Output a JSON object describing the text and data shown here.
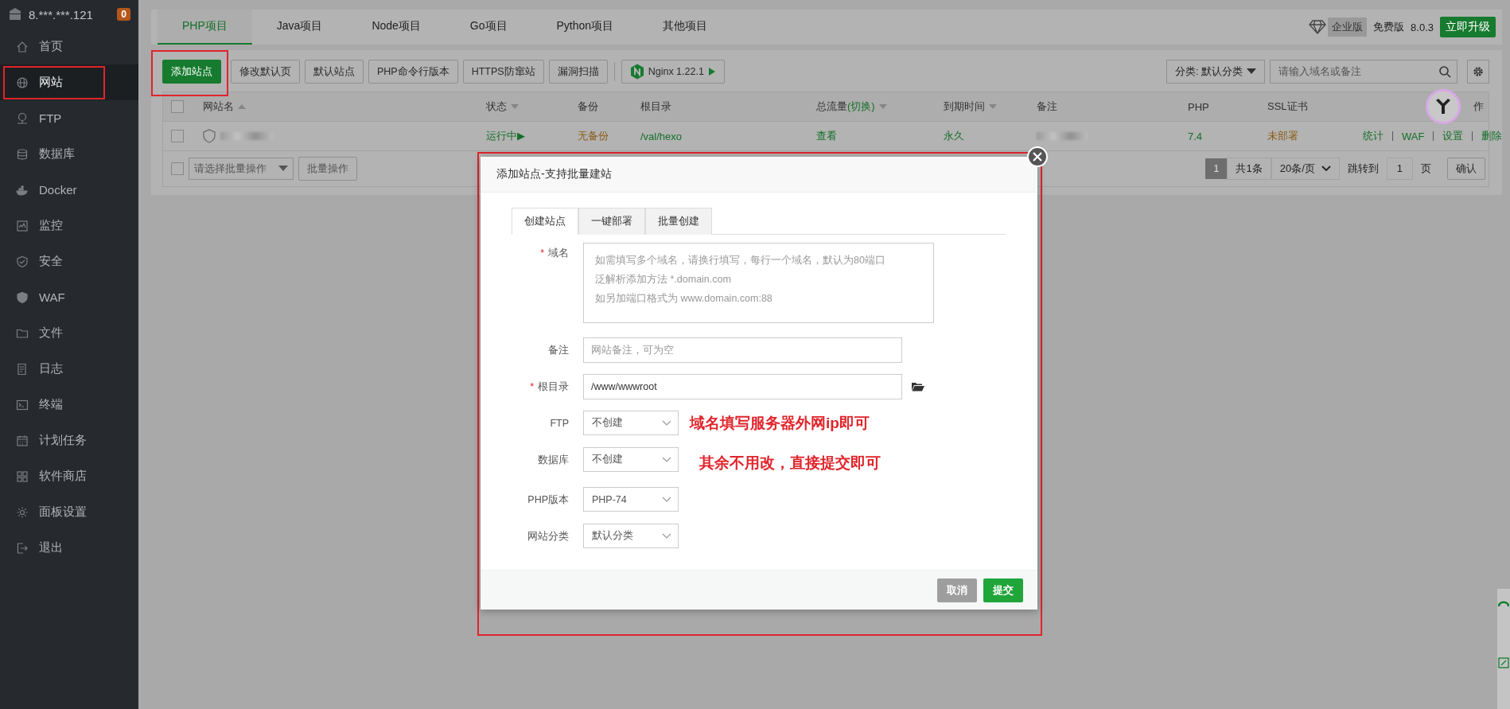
{
  "sidebar": {
    "server": "8.***.***.121",
    "badge": "0",
    "items": [
      {
        "label": "首页",
        "selected": false,
        "annotated": false
      },
      {
        "label": "网站",
        "selected": true,
        "annotated": true
      },
      {
        "label": "FTP",
        "selected": false,
        "annotated": false
      },
      {
        "label": "数据库",
        "selected": false,
        "annotated": false
      },
      {
        "label": "Docker",
        "selected": false,
        "annotated": false
      },
      {
        "label": "监控",
        "selected": false,
        "annotated": false
      },
      {
        "label": "安全",
        "selected": false,
        "annotated": false
      },
      {
        "label": "WAF",
        "selected": false,
        "annotated": false
      },
      {
        "label": "文件",
        "selected": false,
        "annotated": false
      },
      {
        "label": "日志",
        "selected": false,
        "annotated": false
      },
      {
        "label": "终端",
        "selected": false,
        "annotated": false
      },
      {
        "label": "计划任务",
        "selected": false,
        "annotated": false
      },
      {
        "label": "软件商店",
        "selected": false,
        "annotated": false
      },
      {
        "label": "面板设置",
        "selected": false,
        "annotated": false
      },
      {
        "label": "退出",
        "selected": false,
        "annotated": false
      }
    ]
  },
  "project_tabs": [
    {
      "label": "PHP项目",
      "selected": true
    },
    {
      "label": "Java项目",
      "selected": false
    },
    {
      "label": "Node项目",
      "selected": false
    },
    {
      "label": "Go项目",
      "selected": false
    },
    {
      "label": "Python项目",
      "selected": false
    },
    {
      "label": "其他项目",
      "selected": false
    }
  ],
  "edition": {
    "enterprise": "企业版",
    "free": "免费版",
    "version": "8.0.3",
    "upgrade": "立即升级"
  },
  "toolbar": {
    "buttons": [
      {
        "label": "添加站点",
        "kind": "primary",
        "annotated": true
      },
      {
        "label": "修改默认页",
        "kind": "default",
        "annotated": false
      },
      {
        "label": "默认站点",
        "kind": "default",
        "annotated": false
      },
      {
        "label": "PHP命令行版本",
        "kind": "default",
        "annotated": false
      },
      {
        "label": "HTTPS防窜站",
        "kind": "default",
        "annotated": false
      },
      {
        "label": "漏洞扫描",
        "kind": "default",
        "annotated": false
      },
      {
        "label": "Nginx 1.22.1",
        "kind": "nginx",
        "annotated": false
      }
    ],
    "category": "分类: 默认分类",
    "search_placeholder": "请输入域名或备注"
  },
  "table": {
    "select_all_checked": false,
    "columns": [
      {
        "label": "网站名",
        "kind": "sort-asc"
      },
      {
        "label": "状态",
        "kind": "sort-desc"
      },
      {
        "label": "备份",
        "kind": "plain"
      },
      {
        "label": "根目录",
        "kind": "plain"
      },
      {
        "label": "总流量",
        "extra": "(切换)",
        "kind": "sort-desc"
      },
      {
        "label": "到期时间",
        "kind": "sort-desc"
      },
      {
        "label": "备注",
        "kind": "plain"
      },
      {
        "label": "PHP",
        "kind": "plain"
      },
      {
        "label": "SSL证书",
        "kind": "plain"
      },
      {
        "label": "作",
        "kind": "plain"
      }
    ],
    "rows": [
      {
        "checked": false,
        "status": "运行中▶",
        "backup": "无备份",
        "root": "/val/hexo",
        "traffic": "查看",
        "expiry": "永久",
        "php": "7.4",
        "ssl": "未部署",
        "actions": [
          "统计",
          "WAF",
          "设置",
          "删除"
        ]
      }
    ],
    "batch_checked": false,
    "batch_placeholder": "请选择批量操作",
    "batch_button": "批量操作",
    "pagination": {
      "current": "1",
      "total": "共1条",
      "per_page": "20条/页",
      "jump": "跳转到",
      "page": "1",
      "page_unit": "页",
      "confirm": "确认"
    }
  },
  "dialog": {
    "title": "添加站点-支持批量建站",
    "tabs": [
      {
        "label": "创建站点",
        "selected": true
      },
      {
        "label": "一键部署",
        "selected": false
      },
      {
        "label": "批量创建",
        "selected": false
      }
    ],
    "fields": [
      {
        "kind": "textarea",
        "label": "域名",
        "marker": "*",
        "placeholder_lines": [
          "如需填写多个域名，请换行填写，每行一个域名，默认为80端口",
          "泛解析添加方法 *.domain.com",
          "如另加端口格式为 www.domain.com:88"
        ]
      },
      {
        "kind": "input",
        "label": "备注",
        "placeholder": "网站备注，可为空"
      },
      {
        "kind": "path",
        "label": "根目录",
        "marker": "*",
        "value": "/www/wwwroot"
      },
      {
        "kind": "select",
        "label": "FTP",
        "value": "不创建",
        "annotation": "域名填写服务器外网ip即可"
      },
      {
        "kind": "select",
        "label": "数据库",
        "value": "不创建",
        "annotation": "其余不用改，直接提交即可"
      },
      {
        "kind": "select",
        "label": "PHP版本",
        "value": "PHP-74"
      },
      {
        "kind": "select",
        "label": "网站分类",
        "value": "默认分类"
      }
    ],
    "buttons": [
      {
        "label": "取消",
        "disabled": true
      },
      {
        "label": "提交",
        "disabled": false
      }
    ]
  }
}
